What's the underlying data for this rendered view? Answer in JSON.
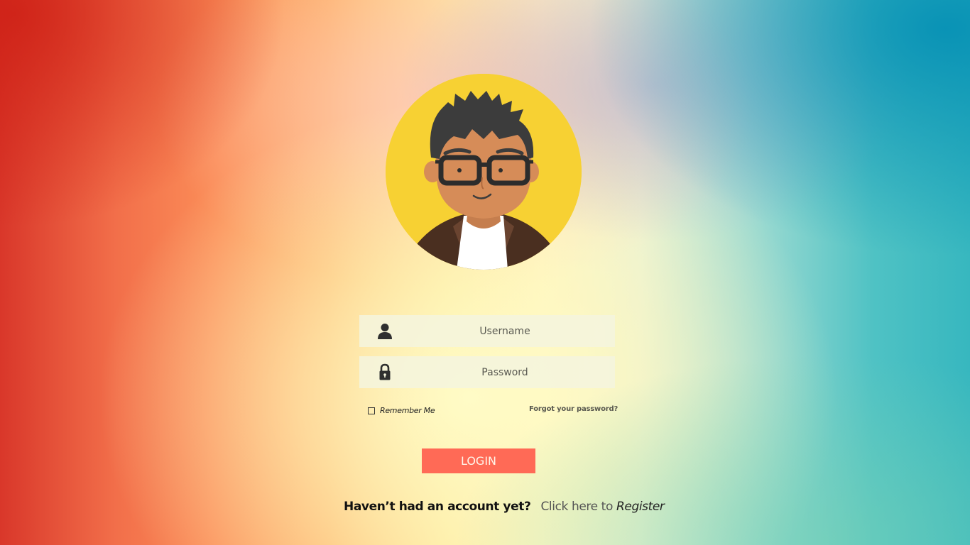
{
  "colors": {
    "avatar_bg": "#f7d133",
    "login_button": "#ff6a56",
    "field_bg": "#f5f5de"
  },
  "avatar": {
    "icon": "user-avatar-illustration"
  },
  "form": {
    "username": {
      "placeholder": "Username",
      "icon": "user-icon"
    },
    "password": {
      "placeholder": "Password",
      "icon": "lock-icon"
    },
    "remember_label": "Remember Me",
    "forgot_label": "Forgot your password?",
    "login_label": "LOGIN"
  },
  "register": {
    "question": "Haven’t had an account yet?",
    "prefix": "Click here to",
    "link": "Register"
  }
}
